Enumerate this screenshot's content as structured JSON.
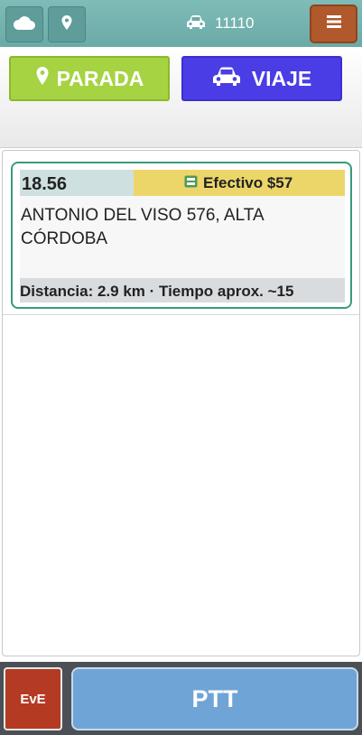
{
  "header": {
    "cloud_icon": "cloud-icon",
    "location_icon": "map-pin-icon",
    "vehicle_icon": "car-icon",
    "unit_number": "11110",
    "menu_icon": "hamburger-menu-icon"
  },
  "actions": {
    "parada_label": "PARADA",
    "viaje_label": "VIAJE"
  },
  "trip": {
    "time": "18.56",
    "payment": "Efectivo $57",
    "payment_icon": "cash-icon",
    "address": "ANTONIO DEL VISO 576, ALTA CÓRDOBA",
    "info": "Distancia: 2.9 km · Tiempo aprox. ~15"
  },
  "footer": {
    "eve_label": "EvE",
    "ptt_label": "PTT"
  },
  "colors": {
    "topbar": "#6aaaa6",
    "parada": "#a6d342",
    "viaje": "#4a3de6",
    "menu": "#b0592c",
    "card_border": "#3a9a7c",
    "payment_bg": "#ecd66a",
    "eve": "#b53a23",
    "ptt": "#6fa4d6"
  }
}
